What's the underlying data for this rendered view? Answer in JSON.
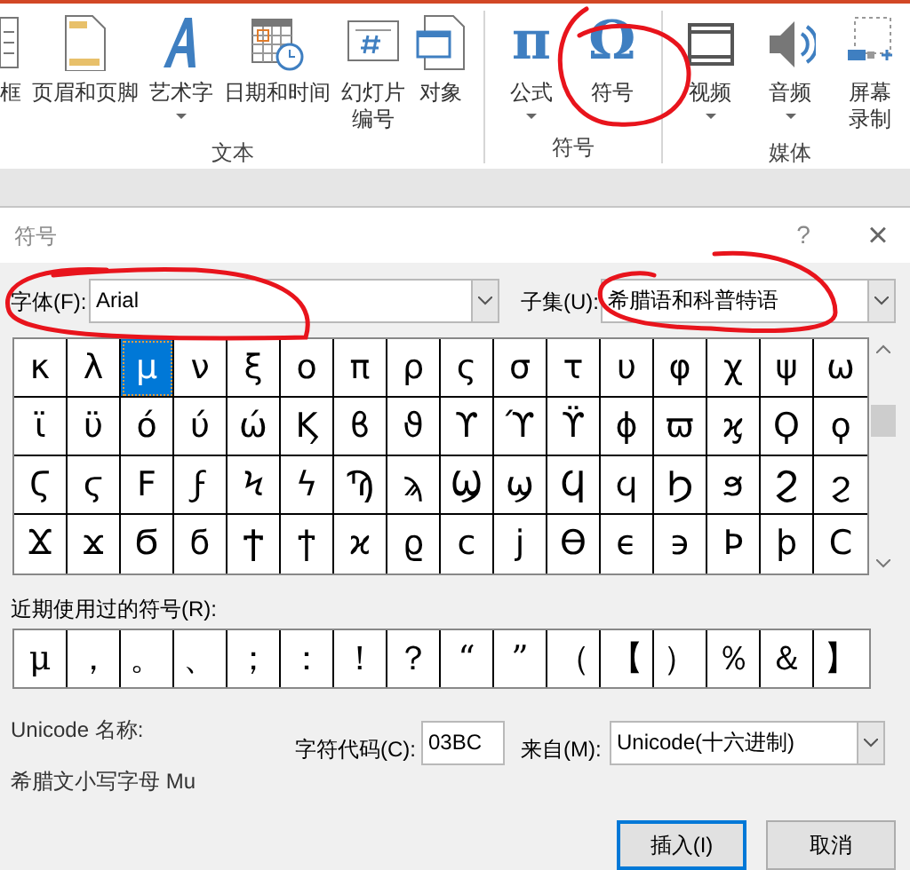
{
  "ribbon": {
    "groups": [
      {
        "label": "文本",
        "items": [
          {
            "kind": "textbox",
            "label": "框",
            "dropdown": false
          },
          {
            "kind": "header-footer",
            "label": "页眉和页脚",
            "dropdown": false
          },
          {
            "kind": "wordart",
            "label": "艺术字",
            "dropdown": true
          },
          {
            "kind": "datetime",
            "label": "日期和时间",
            "dropdown": false
          },
          {
            "kind": "slide-number",
            "label": [
              "幻灯片",
              "编号"
            ],
            "dropdown": false
          },
          {
            "kind": "object",
            "label": "对象",
            "dropdown": false
          }
        ]
      },
      {
        "label": "符号",
        "items": [
          {
            "kind": "equation",
            "glyph": "π",
            "label": "公式",
            "dropdown": true
          },
          {
            "kind": "symbol",
            "glyph": "Ω",
            "label": "符号",
            "dropdown": false
          }
        ]
      },
      {
        "label": "媒体",
        "items": [
          {
            "kind": "video",
            "label": "视频",
            "dropdown": true
          },
          {
            "kind": "audio",
            "label": "音频",
            "dropdown": true
          },
          {
            "kind": "screen-recording",
            "label": [
              "屏幕",
              "录制"
            ],
            "dropdown": false
          }
        ]
      }
    ]
  },
  "dialog": {
    "title": "符号",
    "help": "?",
    "close": "×",
    "font_label": "字体(F):",
    "font_value": "Arial",
    "subset_label": "子集(U):",
    "subset_value": "希腊语和科普特语",
    "symbols": [
      {
        "char": "κ",
        "selected": false
      },
      {
        "char": "λ",
        "selected": false
      },
      {
        "char": "μ",
        "selected": true
      },
      {
        "char": "ν",
        "selected": false
      },
      {
        "char": "ξ",
        "selected": false
      },
      {
        "char": "ο",
        "selected": false
      },
      {
        "char": "π",
        "selected": false
      },
      {
        "char": "ρ",
        "selected": false
      },
      {
        "char": "ς",
        "selected": false
      },
      {
        "char": "σ",
        "selected": false
      },
      {
        "char": "τ",
        "selected": false
      },
      {
        "char": "υ",
        "selected": false
      },
      {
        "char": "φ",
        "selected": false
      },
      {
        "char": "χ",
        "selected": false
      },
      {
        "char": "ψ",
        "selected": false
      },
      {
        "char": "ω",
        "selected": false
      },
      {
        "char": "ϊ",
        "selected": false
      },
      {
        "char": "ϋ",
        "selected": false
      },
      {
        "char": "ό",
        "selected": false
      },
      {
        "char": "ύ",
        "selected": false
      },
      {
        "char": "ώ",
        "selected": false
      },
      {
        "char": "Ϗ",
        "selected": false
      },
      {
        "char": "ϐ",
        "selected": false
      },
      {
        "char": "ϑ",
        "selected": false
      },
      {
        "char": "ϒ",
        "selected": false
      },
      {
        "char": "ϓ",
        "selected": false
      },
      {
        "char": "ϔ",
        "selected": false
      },
      {
        "char": "ϕ",
        "selected": false
      },
      {
        "char": "ϖ",
        "selected": false
      },
      {
        "char": "ϗ",
        "selected": false
      },
      {
        "char": "Ϙ",
        "selected": false
      },
      {
        "char": "ϙ",
        "selected": false
      },
      {
        "char": "Ϛ",
        "selected": false
      },
      {
        "char": "ϛ",
        "selected": false
      },
      {
        "char": "Ϝ",
        "selected": false
      },
      {
        "char": "ϝ",
        "selected": false
      },
      {
        "char": "Ϟ",
        "selected": false
      },
      {
        "char": "ϟ",
        "selected": false
      },
      {
        "char": "Ϡ",
        "selected": false
      },
      {
        "char": "ϡ",
        "selected": false
      },
      {
        "char": "Ϣ",
        "selected": false
      },
      {
        "char": "ϣ",
        "selected": false
      },
      {
        "char": "Ϥ",
        "selected": false
      },
      {
        "char": "ϥ",
        "selected": false
      },
      {
        "char": "Ϧ",
        "selected": false
      },
      {
        "char": "ϧ",
        "selected": false
      },
      {
        "char": "Ϩ",
        "selected": false
      },
      {
        "char": "ϩ",
        "selected": false
      },
      {
        "char": "Ϫ",
        "selected": false
      },
      {
        "char": "ϫ",
        "selected": false
      },
      {
        "char": "Ϭ",
        "selected": false
      },
      {
        "char": "ϭ",
        "selected": false
      },
      {
        "char": "Ϯ",
        "selected": false
      },
      {
        "char": "ϯ",
        "selected": false
      },
      {
        "char": "ϰ",
        "selected": false
      },
      {
        "char": "ϱ",
        "selected": false
      },
      {
        "char": "ϲ",
        "selected": false
      },
      {
        "char": "ϳ",
        "selected": false
      },
      {
        "char": "ϴ",
        "selected": false
      },
      {
        "char": "ϵ",
        "selected": false
      },
      {
        "char": "϶",
        "selected": false
      },
      {
        "char": "Ϸ",
        "selected": false
      },
      {
        "char": "ϸ",
        "selected": false
      },
      {
        "char": "Ϲ",
        "selected": false
      }
    ],
    "recent_label": "近期使用过的符号(R):",
    "recent": [
      "μ",
      "，",
      "。",
      "、",
      "；",
      "：",
      "！",
      "？",
      "“",
      "”",
      "（",
      "【",
      "）",
      "％",
      "＆",
      "】"
    ],
    "unicode_name_label": "Unicode 名称:",
    "unicode_name": "希腊文小写字母 Mu",
    "code_label": "字符代码(C):",
    "code_value": "03BC",
    "from_label": "来自(M):",
    "from_value": "Unicode(十六进制)",
    "buttons": [
      {
        "label": "插入(I)",
        "default": true
      },
      {
        "label": "取消",
        "default": false
      }
    ]
  },
  "annotations": [
    {
      "kind": "ring"
    },
    {
      "kind": "ring"
    },
    {
      "kind": "ring"
    }
  ]
}
